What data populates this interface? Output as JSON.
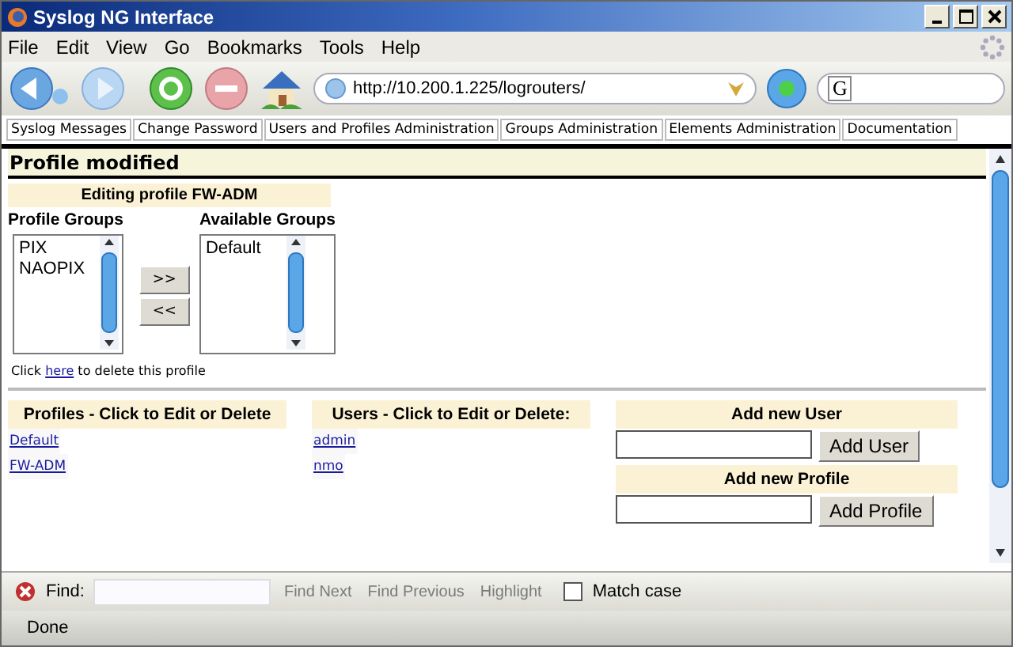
{
  "window": {
    "title": "Syslog NG Interface"
  },
  "menu": [
    "File",
    "Edit",
    "View",
    "Go",
    "Bookmarks",
    "Tools",
    "Help"
  ],
  "address": {
    "value": "http://10.200.1.225/logrouters/"
  },
  "search": {
    "value": "G"
  },
  "nav_tabs": [
    "Syslog Messages",
    "Change Password",
    "Users and Profiles Administration",
    "Groups Administration",
    "Elements Administration",
    "Documentation"
  ],
  "message": "Profile modified",
  "edit_panel": {
    "title": "Editing profile FW-ADM",
    "profile_groups_label": "Profile Groups",
    "available_groups_label": "Available Groups",
    "profile_groups": [
      "PIX",
      "NAOPIX"
    ],
    "available_groups": [
      "Default"
    ],
    "add_button": ">>",
    "remove_button": "<<",
    "delete_note": {
      "before": "Click",
      "link": "here",
      "after": "to delete this profile"
    }
  },
  "profiles": {
    "header": "Profiles - Click to Edit or Delete",
    "items": [
      "Default",
      "FW-ADM"
    ]
  },
  "users": {
    "header": "Users - Click to Edit or Delete:",
    "items": [
      "admin",
      "nmo"
    ]
  },
  "add_user": {
    "header": "Add new User",
    "button": "Add User"
  },
  "add_profile": {
    "header": "Add new Profile",
    "button": "Add Profile"
  },
  "find_bar": {
    "label": "Find:",
    "buttons": [
      {
        "label": "Find Next",
        "disabled": true
      },
      {
        "label": "Find Previous",
        "disabled": true
      },
      {
        "label": "Highlight",
        "disabled": true
      }
    ],
    "match_case": {
      "label": "Match case",
      "checked": false
    }
  },
  "status_bar": {
    "text": "Done"
  }
}
